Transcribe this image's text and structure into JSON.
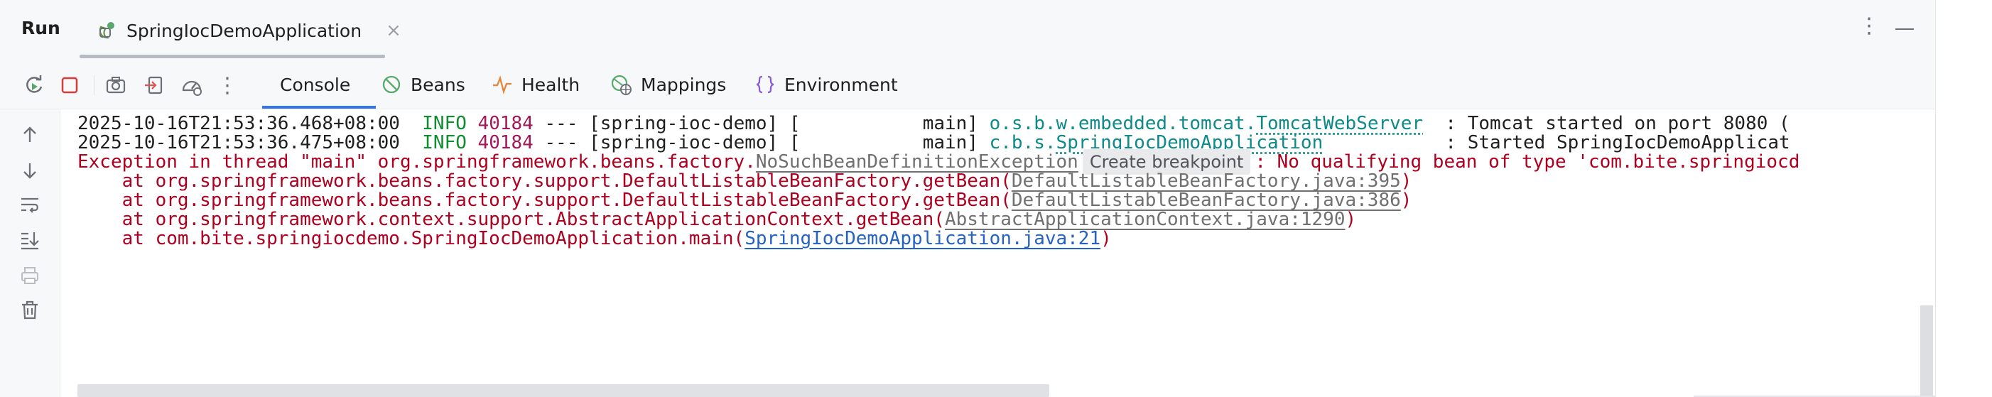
{
  "header": {
    "run_label": "Run",
    "tab_label": "SpringIocDemoApplication",
    "tab_close": "×",
    "more_glyph": "⋮"
  },
  "toolbar": {
    "buttons": [
      "rerun-icon",
      "stop-icon",
      "camera-icon",
      "restore-layout-icon",
      "profiler-icon",
      "more-icon"
    ],
    "more_glyph": "⋮",
    "tabs": [
      {
        "label": "Console",
        "icon": "console",
        "active": true
      },
      {
        "label": "Beans",
        "icon": "beans-icon"
      },
      {
        "label": "Health",
        "icon": "health-icon"
      },
      {
        "label": "Mappings",
        "icon": "mappings-icon"
      },
      {
        "label": "Environment",
        "icon": "environment-icon"
      }
    ]
  },
  "gutter": {
    "buttons": [
      "up-arrow-icon",
      "down-arrow-icon",
      "soft-wrap-icon",
      "scroll-to-end-icon",
      "print-icon",
      "trash-icon"
    ]
  },
  "console": {
    "line1": {
      "ts": "2025-10-16T21:53:36.468+08:00",
      "level": "INFO",
      "pid": "40184",
      "mid": " --- [spring-ioc-demo] [           main] ",
      "logger_prefix": "o.s.b.w.embedded.tomcat.",
      "logger_class": "TomcatWebServer",
      "msg": "  : Tomcat started on port 8080 ("
    },
    "line2": {
      "ts": "2025-10-16T21:53:36.475+08:00",
      "level": "INFO",
      "pid": "40184",
      "mid": " --- [spring-ioc-demo] [           main] ",
      "logger_prefix": "c.b.s.",
      "logger_class": "SpringIocDemoApplication",
      "msg": "           : Started SpringIocDemoApplicat"
    },
    "exception": {
      "prefix": "Exception in thread \"main\" org.springframework.beans.factory.",
      "class": "NoSuchBeanDefinitionException",
      "breakpoint": "Create breakpoint",
      "msg": ": No qualifying bean of type 'com.bite.springiocd"
    },
    "stack": [
      {
        "text": "    at org.springframework.beans.factory.support.DefaultListableBeanFactory.getBean(",
        "link": "DefaultListableBeanFactory.java:395",
        "close": ")",
        "style": "gray"
      },
      {
        "text": "    at org.springframework.beans.factory.support.DefaultListableBeanFactory.getBean(",
        "link": "DefaultListableBeanFactory.java:386",
        "close": ")",
        "style": "gray"
      },
      {
        "text": "    at org.springframework.context.support.AbstractApplicationContext.getBean(",
        "link": "AbstractApplicationContext.java:1290",
        "close": ")",
        "style": "gray"
      },
      {
        "text": "    at com.bite.springiocdemo.SpringIocDemoApplication.main(",
        "link": "SpringIocDemoApplication.java:21",
        "close": ")",
        "style": "blue"
      }
    ]
  },
  "colors": {
    "accent": "#3574f0",
    "info": "#118c2e",
    "pid": "#a4175a",
    "logger": "#0e8a8a",
    "error": "#b00020",
    "source_link": "#2462c4"
  }
}
